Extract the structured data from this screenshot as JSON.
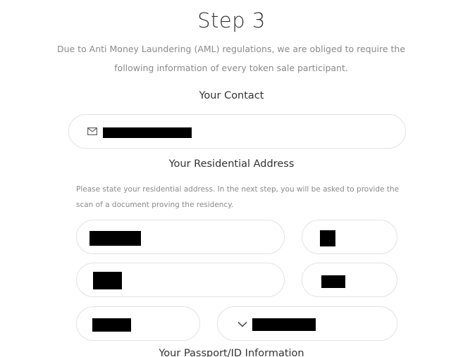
{
  "step_title": "Step 3",
  "intro": "Due to Anti Money Laundering (AML) regulations, we are obliged to require the following information of every token sale participant.",
  "contact": {
    "heading": "Your Contact",
    "email_icon": "mail-icon"
  },
  "address": {
    "heading": "Your Residential Address",
    "note": "Please state your residential address. In the next step, you will be asked to provide the scan of a document proving the residency.",
    "country_select_icon": "chevron-down-icon"
  },
  "passport": {
    "heading": "Your Passport/ID Information"
  }
}
